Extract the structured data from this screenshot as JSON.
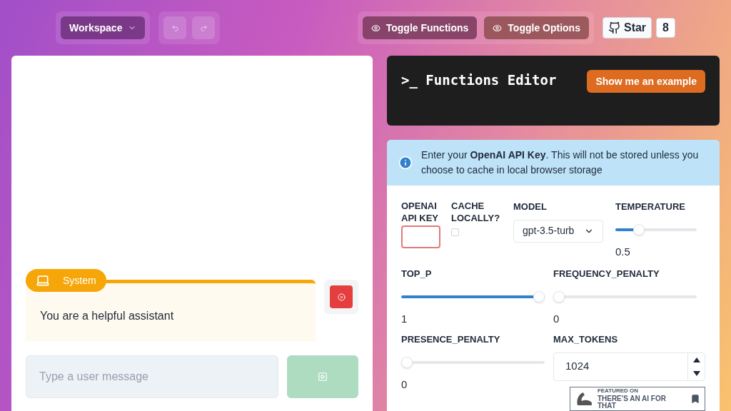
{
  "toolbar": {
    "workspace": "Workspace",
    "toggles": [
      "Toggle Functions",
      "Toggle Options"
    ],
    "star": {
      "label": "Star",
      "count": "8"
    }
  },
  "chat": {
    "messages": [
      {
        "role": "System",
        "text": "You are a helpful assistant"
      }
    ],
    "input": {
      "placeholder": "Type a user message"
    }
  },
  "functions_editor": {
    "title": ">_ Functions Editor",
    "example_button": "Show me an example"
  },
  "options": {
    "notice": "Enter your **OpenAI API Key**. This will not be stored unless you choose to cache in local browser storage",
    "api_key": {
      "label": "OPENAI API KEY",
      "invalid": true
    },
    "cache": {
      "label": "CACHE LOCALLY?",
      "checked": false
    },
    "model": {
      "label": "MODEL",
      "value": "gpt-3.5-turb"
    },
    "sliders": [
      {
        "label": "TEMPERATURE",
        "level": 0.25,
        "reading": "0.5"
      },
      {
        "label": "TOP_P",
        "level": 1,
        "reading": "1"
      },
      {
        "label": "FREQUENCY_PENALTY",
        "level": 0,
        "reading": "0"
      },
      {
        "label": "PRESENCE_PENALTY",
        "level": 0,
        "reading": "0"
      }
    ],
    "max_tokens": {
      "label": "MAX_TOKENS",
      "value": "1024"
    }
  },
  "badge": {
    "small": "FEATURED ON",
    "large": "THERE'S AN AI FOR THAT"
  }
}
